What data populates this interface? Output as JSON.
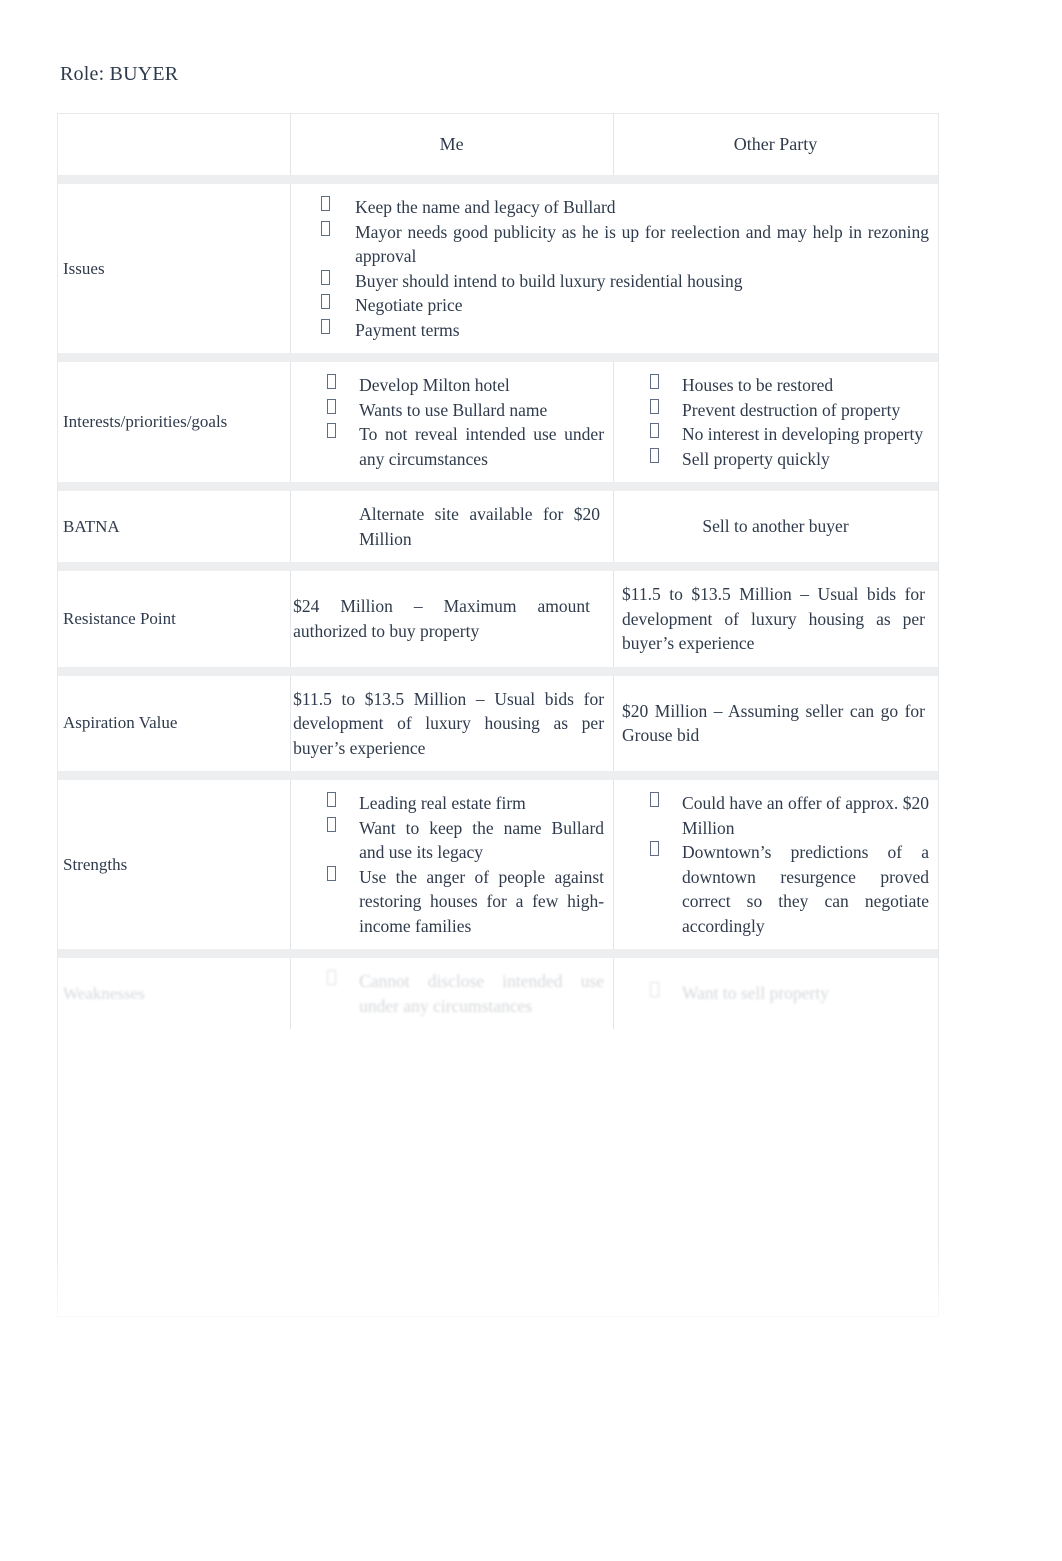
{
  "document": {
    "role_line": "Role: BUYER"
  },
  "table": {
    "headers": {
      "blank": "",
      "me": "Me",
      "other_party": "Other Party"
    },
    "rows": [
      {
        "label": "Issues",
        "me_spans_full_width": true,
        "me": {
          "type": "bullets",
          "items": [
            "Keep the name and legacy of Bullard",
            "Mayor needs good publicity as he is up for reelection and may help in rezoning approval",
            "Buyer should intend to build luxury residential housing",
            "Negotiate price",
            "Payment terms"
          ]
        },
        "other": {
          "type": "empty",
          "items": []
        }
      },
      {
        "label": "Interests/priorities/goals",
        "me": {
          "type": "bullets",
          "items": [
            "Develop Milton hotel",
            "Wants to use Bullard name",
            "To not reveal intended use under any circumstances"
          ]
        },
        "other": {
          "type": "bullets",
          "items": [
            "Houses to be restored",
            "Prevent destruction of property",
            "No interest in developing property",
            "Sell property quickly"
          ]
        }
      },
      {
        "label": "BATNA",
        "me": {
          "type": "text",
          "text": "Alternate site available for $20 Million"
        },
        "other": {
          "type": "text-center",
          "text": "Sell to another buyer"
        }
      },
      {
        "label": "Resistance Point",
        "me": {
          "type": "text",
          "text": "$24 Million – Maximum amount authorized to buy property"
        },
        "other": {
          "type": "text",
          "text": "$11.5 to $13.5 Million – Usual bids for development of luxury housing as per buyer’s experience"
        }
      },
      {
        "label": "Aspiration Value",
        "me": {
          "type": "text",
          "text": "$11.5 to $13.5 Million – Usual bids for development of luxury housing as per buyer’s experience"
        },
        "other": {
          "type": "text",
          "text": "$20 Million – Assuming seller can go for Grouse bid"
        }
      },
      {
        "label": "Strengths",
        "me": {
          "type": "bullets",
          "items": [
            "Leading real estate firm",
            "Want to keep the name Bullard and use its legacy",
            "Use the anger of people against restoring houses for a few high-income families"
          ]
        },
        "other": {
          "type": "bullets",
          "items": [
            "Could have an offer of approx. $20 Million",
            "Downtown’s predictions of a downtown resurgence proved correct so they can negotiate accordingly"
          ]
        }
      },
      {
        "label": "Weaknesses",
        "cut_off": true,
        "me": {
          "type": "bullets",
          "items": [
            "Cannot disclose intended use under any circumstances"
          ]
        },
        "other": {
          "type": "bullets",
          "items": [
            "Want to sell property"
          ]
        }
      }
    ]
  }
}
